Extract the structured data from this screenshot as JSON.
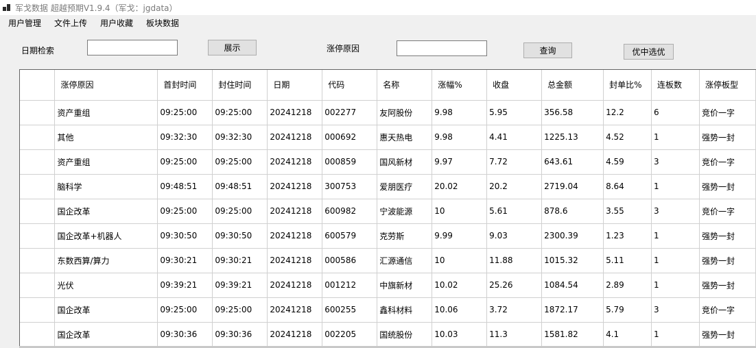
{
  "window": {
    "title": "军戈数据 超越预期V1.9.4（军戈：jgdata）"
  },
  "menu": [
    "用户管理",
    "文件上传",
    "用户收藏",
    "板块数据"
  ],
  "toolbar": {
    "date_label": "日期检索",
    "date_value": "",
    "show_label": "展示",
    "reason_label": "涨停原因",
    "reason_value": "",
    "query_label": "查询",
    "pick_label": "优中选优"
  },
  "table": {
    "columns": [
      "涨停原因",
      "首封时间",
      "封住时间",
      "日期",
      "代码",
      "名称",
      "涨幅%",
      "收盘",
      "总金额",
      "封单比%",
      "连板数",
      "涨停板型"
    ],
    "rows": [
      [
        "资产重组",
        "09:25:00",
        "09:25:00",
        "20241218",
        "002277",
        "友阿股份",
        "9.98",
        "5.95",
        "356.58",
        "12.2",
        "6",
        "竞价一字"
      ],
      [
        "其他",
        "09:32:30",
        "09:32:30",
        "20241218",
        "000692",
        "惠天热电",
        "9.98",
        "4.41",
        "1225.13",
        "4.52",
        "1",
        "强势一封"
      ],
      [
        "资产重组",
        "09:25:00",
        "09:25:00",
        "20241218",
        "000859",
        "国风新材",
        "9.97",
        "7.72",
        "643.61",
        "4.59",
        "3",
        "竞价一字"
      ],
      [
        "脑科学",
        "09:48:51",
        "09:48:51",
        "20241218",
        "300753",
        "爱朋医疗",
        "20.02",
        "20.2",
        "2719.04",
        "8.64",
        "1",
        "强势一封"
      ],
      [
        "国企改革",
        "09:25:00",
        "09:25:00",
        "20241218",
        "600982",
        "宁波能源",
        "10",
        "5.61",
        "878.6",
        "3.55",
        "3",
        "竞价一字"
      ],
      [
        "国企改革+机器人",
        "09:30:50",
        "09:30:50",
        "20241218",
        "600579",
        "克劳斯",
        "9.99",
        "9.03",
        "2300.39",
        "1.23",
        "1",
        "强势一封"
      ],
      [
        "东数西算/算力",
        "09:30:21",
        "09:30:21",
        "20241218",
        "000586",
        "汇源通信",
        "10",
        "11.88",
        "1015.32",
        "5.11",
        "1",
        "强势一封"
      ],
      [
        "光伏",
        "09:39:21",
        "09:39:21",
        "20241218",
        "001212",
        "中旗新材",
        "10.02",
        "25.26",
        "1084.54",
        "2.89",
        "1",
        "强势一封"
      ],
      [
        "国企改革",
        "09:25:00",
        "09:25:00",
        "20241218",
        "600255",
        "鑫科材料",
        "10.06",
        "3.72",
        "1872.17",
        "5.79",
        "3",
        "竞价一字"
      ],
      [
        "国企改革",
        "09:30:36",
        "09:30:36",
        "20241218",
        "002205",
        "国统股份",
        "10.03",
        "11.3",
        "1581.82",
        "4.1",
        "1",
        "强势一封"
      ]
    ]
  }
}
